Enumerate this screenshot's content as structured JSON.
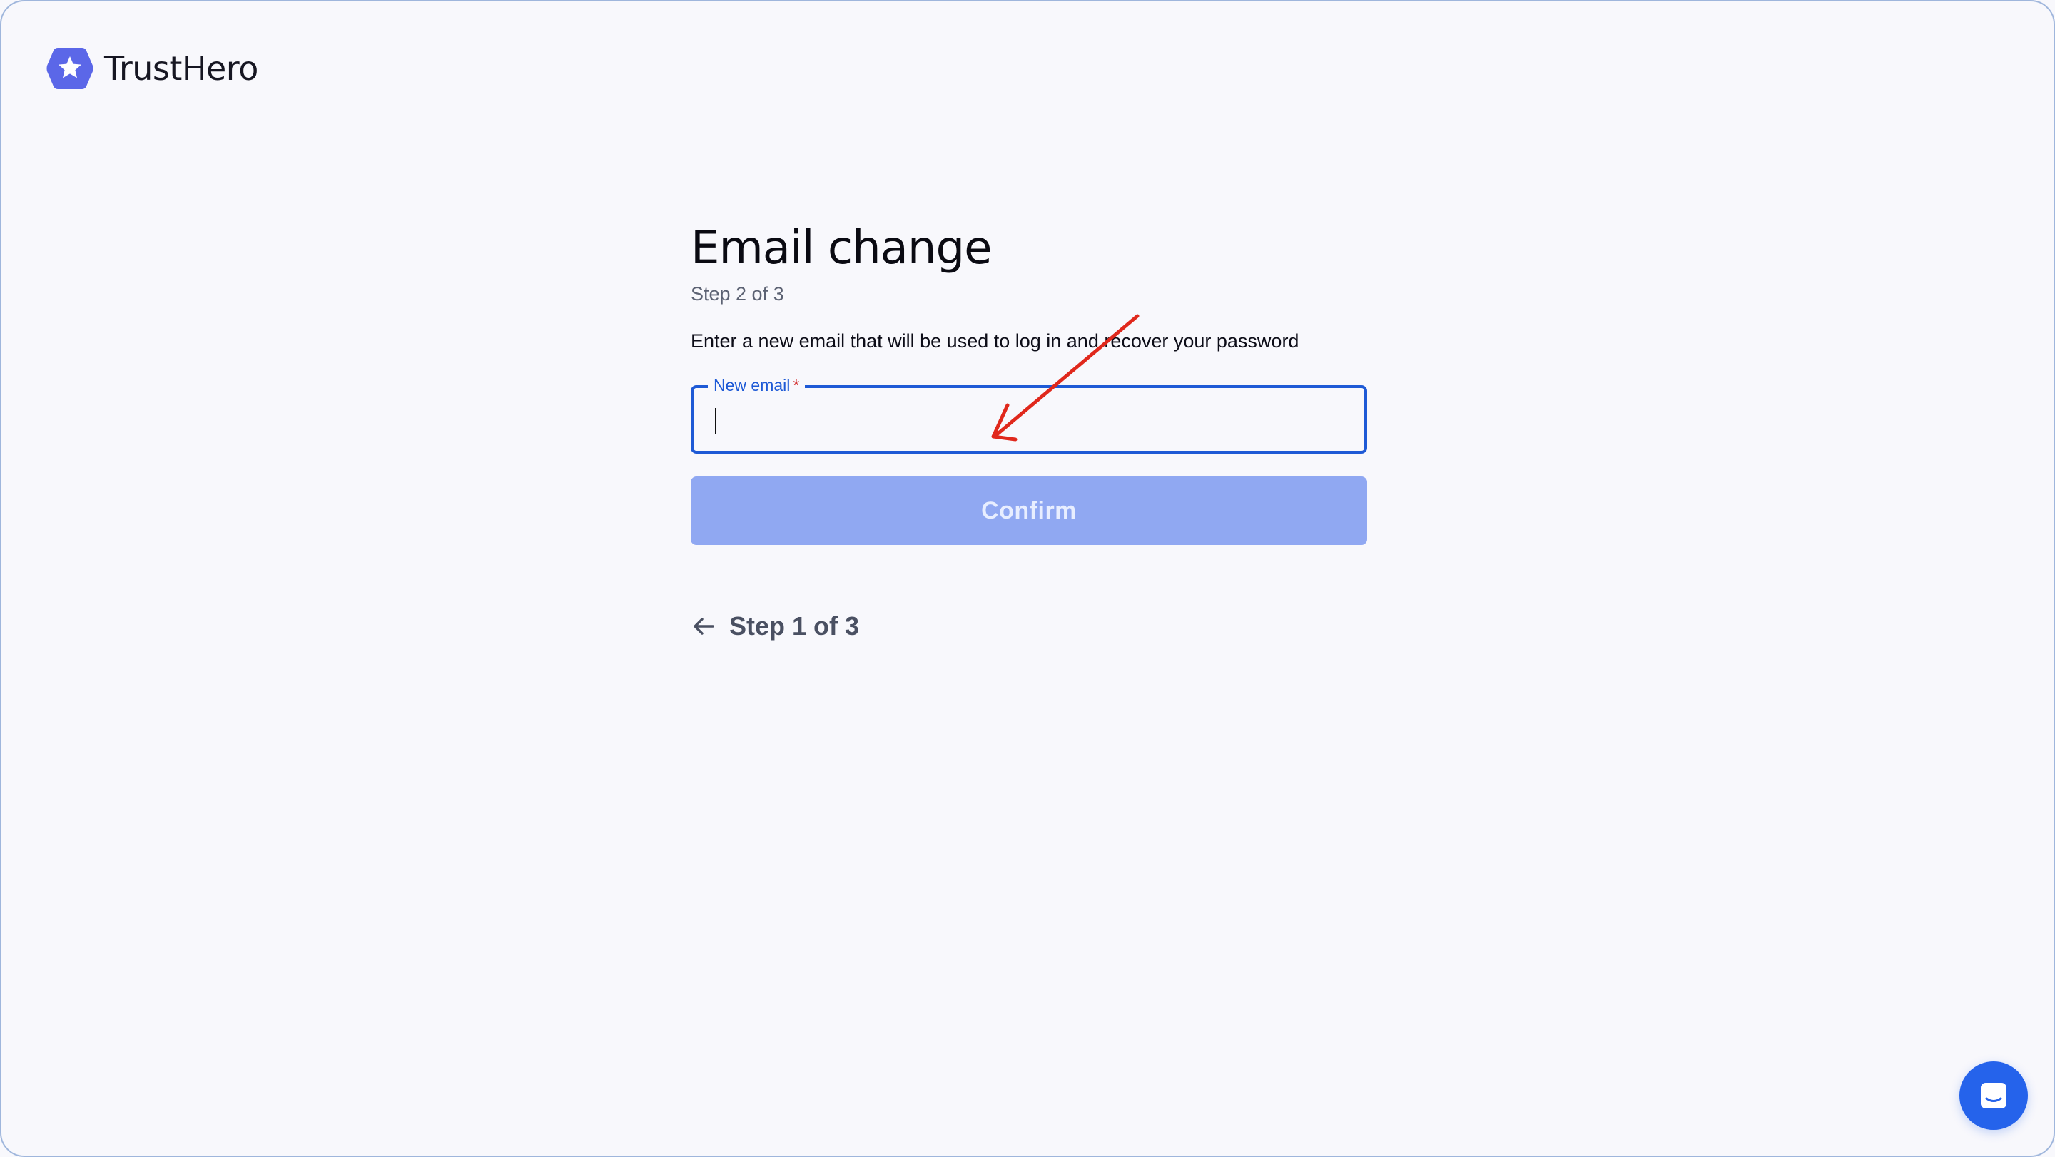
{
  "brand": {
    "name": "TrustHero",
    "logo_icon": "star-hexagon-icon",
    "color": "#5b67e8"
  },
  "page": {
    "title": "Email change",
    "step": "Step 2 of 3",
    "description": "Enter a new email that will be used to log in and recover your password"
  },
  "form": {
    "email_label": "New email",
    "required_mark": "*",
    "email_value": "",
    "confirm_label": "Confirm"
  },
  "navigation": {
    "back_label": "Step 1 of 3",
    "back_icon": "arrow-left-icon"
  },
  "chat": {
    "icon": "chat-bubble-icon"
  },
  "colors": {
    "accent": "#1e5ad6",
    "confirm_disabled": "#90a8f2",
    "annotation": "#e0281c",
    "chat_button": "#2563eb"
  }
}
